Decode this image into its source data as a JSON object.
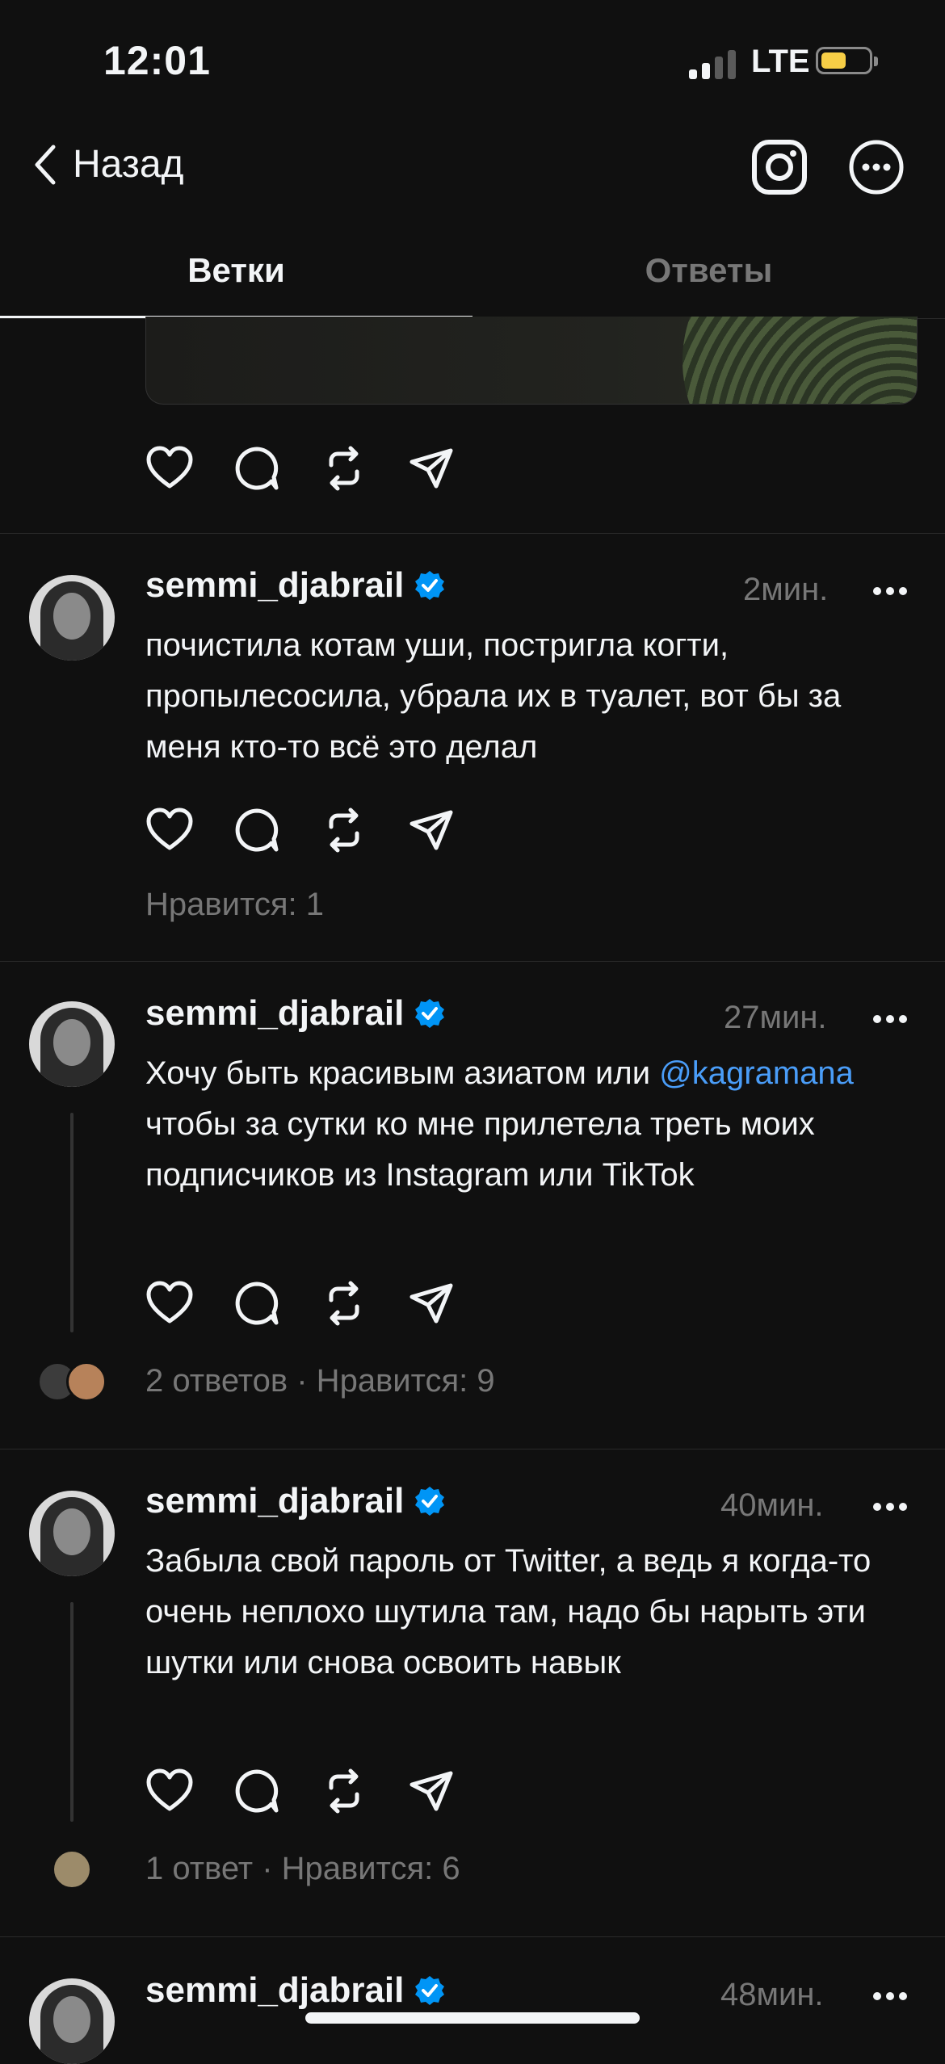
{
  "status_bar": {
    "time": "12:01",
    "network": "LTE"
  },
  "nav": {
    "back_label": "Назад",
    "icons": [
      "instagram-icon",
      "more-circle-icon"
    ]
  },
  "tabs": [
    {
      "label": "Ветки",
      "active": true
    },
    {
      "label": "Ответы",
      "active": false
    }
  ],
  "posts": [
    {
      "username": "semmi_djabrail",
      "time": "2мин.",
      "text": "почистила котам уши, постригла когти, пропылесосила, убрала их в туалет, вот бы за меня кто-то всё это делал",
      "meta": "Нравится: 1"
    },
    {
      "username": "semmi_djabrail",
      "time": "27мин.",
      "text_before": "Хочу быть красивым азиатом или ",
      "mention": "@kagramana",
      "text_after": " чтобы за сутки ко мне прилетела треть моих подписчиков из Instagram или TikTok",
      "meta": "2 ответов · Нравится: 9"
    },
    {
      "username": "semmi_djabrail",
      "time": "40мин.",
      "text": "Забыла свой пароль от Twitter, а ведь я когда-то очень неплохо шутила там, надо бы нарыть эти шутки или снова освоить навык",
      "meta": "1 ответ · Нравится: 6"
    },
    {
      "username": "semmi_djabrail",
      "time": "48мин."
    }
  ],
  "colors": {
    "background": "#101010",
    "text": "#f3f5f7",
    "muted": "#777777",
    "mention": "#4a9df8",
    "verified": "#0095f6",
    "battery": "#f7ce46"
  }
}
